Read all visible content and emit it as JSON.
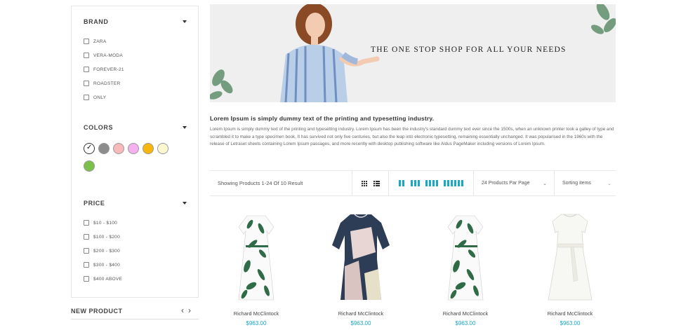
{
  "sidebar": {
    "brand": {
      "title": "BRAND",
      "items": [
        "ZARA",
        "VERA-MODA",
        "FOREVER-21",
        "ROADSTER",
        "ONLY"
      ]
    },
    "colors": {
      "title": "COLORS",
      "swatches": [
        "#ffffff",
        "#8c8c8c",
        "#f7b9b9",
        "#f5b0f0",
        "#f6b70d",
        "#fbf8cf",
        "#7cbf4b"
      ],
      "selected_index": 0
    },
    "price": {
      "title": "PRICE",
      "items": [
        "$10 - $100",
        "$100 - $200",
        "$200 - $300",
        "$300 - $400",
        "$400 ABOVE"
      ]
    }
  },
  "new_product": {
    "title": "NEW PRODUCT",
    "prev_icon": "chevron-left-icon",
    "next_icon": "chevron-right-icon"
  },
  "banner": {
    "headline": "THE ONE STOP SHOP FOR ALL YOUR NEEDS"
  },
  "description": {
    "title": "Lorem Ipsum is simply dummy text of the printing and typesetting industry.",
    "body": "Lorem Ipsum is simply dummy text of the printing and typesetting industry. Lorem Ipsum has been the industry's standard dummy text ever since the 1500s, when an unknown printer took a galley of type and scrambled it to make a type specimen book. It has survived not only five centuries, but also the leap into electronic typesetting, remaining essentially unchanged. It was popularised in the 1960s with the release of Letraset sheets containing Lorem Ipsum passages, and more recently with desktop publishing software like Aldus PageMaker including versions of Lorem Ipsum."
  },
  "toolbar": {
    "showing_text": "Showing Products 1-24 Of 10 Result",
    "per_page": "24 Products Par Page",
    "sorting": "Sorting items",
    "accent": "#1aa8c8"
  },
  "products": [
    {
      "name": "Richard McClintock",
      "price": "$963.00"
    },
    {
      "name": "Richard McClintock",
      "price": "$963.00"
    },
    {
      "name": "Richard McClintock",
      "price": "$963.00"
    },
    {
      "name": "Richard McClintock",
      "price": "$963.00"
    }
  ]
}
